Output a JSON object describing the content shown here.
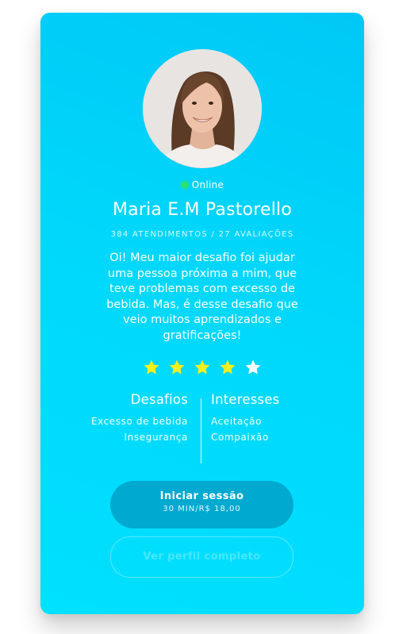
{
  "profile": {
    "status": "Online",
    "name": "Maria E.M Pastorello",
    "stats": "384 ATENDIMENTOS / 27 AVALIAÇÕES",
    "bio": "Oi! Meu maior desafio foi ajudar uma pessoa próxima a mim, que teve problemas com excesso de bebida. Mas, é desse desafio que veio muitos aprendizados e gratificações!",
    "rating": 4,
    "rating_max": 5
  },
  "challenges": {
    "title": "Desafios",
    "items": [
      "Excesso de bebida",
      "Insegurança"
    ]
  },
  "interests": {
    "title": "Interesses",
    "items": [
      "Aceitação",
      "Compaixão"
    ]
  },
  "actions": {
    "start_label": "Iniciar sessão",
    "start_sub": "30 MIN/R$ 18,00",
    "profile_label": "Ver perfil completo"
  },
  "colors": {
    "card_accent": "#00d7fb",
    "online": "#29e26e",
    "star_filled": "#f5ef1c",
    "star_empty": "#ffffff",
    "primary_button": "#00a9cf"
  },
  "icons": {
    "status": "online-dot-icon",
    "star": "star-icon"
  }
}
